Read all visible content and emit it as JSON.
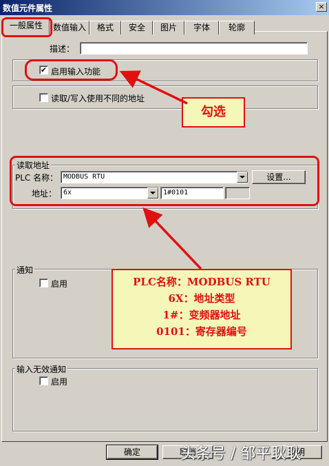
{
  "window": {
    "title": "数值元件属性",
    "close_glyph": "×"
  },
  "tabs": [
    {
      "label": "一般属性"
    },
    {
      "label": "数值输入"
    },
    {
      "label": "格式"
    },
    {
      "label": "安全"
    },
    {
      "label": "图片"
    },
    {
      "label": "字体"
    },
    {
      "label": "轮廓"
    }
  ],
  "general": {
    "description_label": "描述：",
    "description_value": "",
    "enable_input_label": "启用输入功能",
    "enable_input_checked": true,
    "rw_diff_label": "读取/写入使用不同的地址",
    "rw_diff_checked": false
  },
  "read_address": {
    "legend": "读取地址",
    "plc_name_label": "PLC 名称：",
    "plc_name_value": "MODBUS RTU",
    "settings_button": "设置...",
    "address_label": "地址：",
    "address_type_value": "6x",
    "address_value": "1#0101"
  },
  "notify": {
    "legend": "通知",
    "enable_label": "启用"
  },
  "invalid_notify": {
    "legend": "输入无效通知",
    "enable_label": "启用"
  },
  "footer": {
    "ok_button": "确定",
    "cancel_button": "取消",
    "help_button": "说明"
  },
  "annotations": {
    "check_note": "勾选",
    "plc_note": [
      "PLC名称：MODBUS RTU",
      "6X：地址类型",
      "1#：变频器地址",
      "0101：寄存器编号"
    ]
  },
  "watermark": "头条号 / 邹平耿耿",
  "colors": {
    "highlight_red": "#e01010",
    "callout_bg": "#f5f7b8",
    "dialog_bg": "#d4d0c8"
  }
}
